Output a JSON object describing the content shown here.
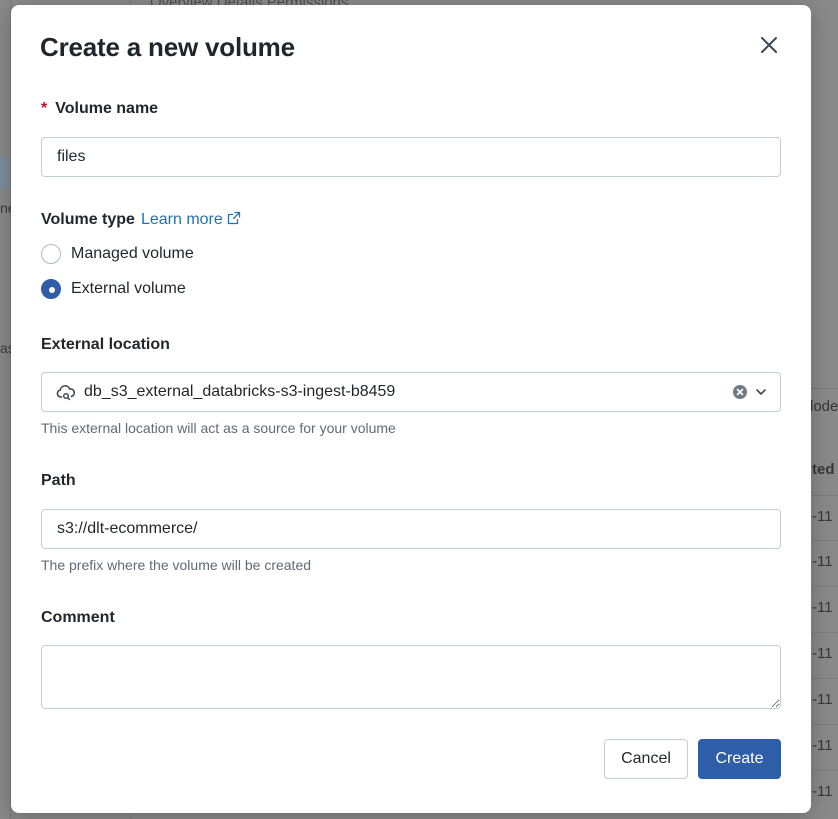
{
  "background": {
    "top_tabs": "Overview   Details   Permissions",
    "side_fragments": [
      "ne",
      "as"
    ],
    "table_headers": [
      "lode",
      "ted"
    ],
    "row_values": [
      "-11",
      "-11",
      "-11",
      "-11",
      "-11",
      "-11",
      "-11"
    ]
  },
  "modal": {
    "title": "Create a new volume",
    "close_icon": "close-icon"
  },
  "volume_name": {
    "required_marker": "*",
    "label": "Volume name",
    "value": "files"
  },
  "volume_type": {
    "label": "Volume type",
    "learn_more": "Learn more",
    "options": [
      {
        "label": "Managed volume",
        "checked": false
      },
      {
        "label": "External volume",
        "checked": true
      }
    ]
  },
  "external_location": {
    "label": "External location",
    "value": "db_s3_external_databricks-s3-ingest-b8459",
    "help": "This external location will act as a source for your volume",
    "icon": "cloud-icon"
  },
  "path": {
    "label": "Path",
    "value": "s3://dlt-ecommerce/",
    "help": "The prefix where the volume will be created"
  },
  "comment": {
    "label": "Comment",
    "value": ""
  },
  "actions": {
    "cancel": "Cancel",
    "create": "Create"
  },
  "colors": {
    "primary": "#2f5ea8",
    "link": "#2272b4",
    "required": "#c8102e"
  }
}
